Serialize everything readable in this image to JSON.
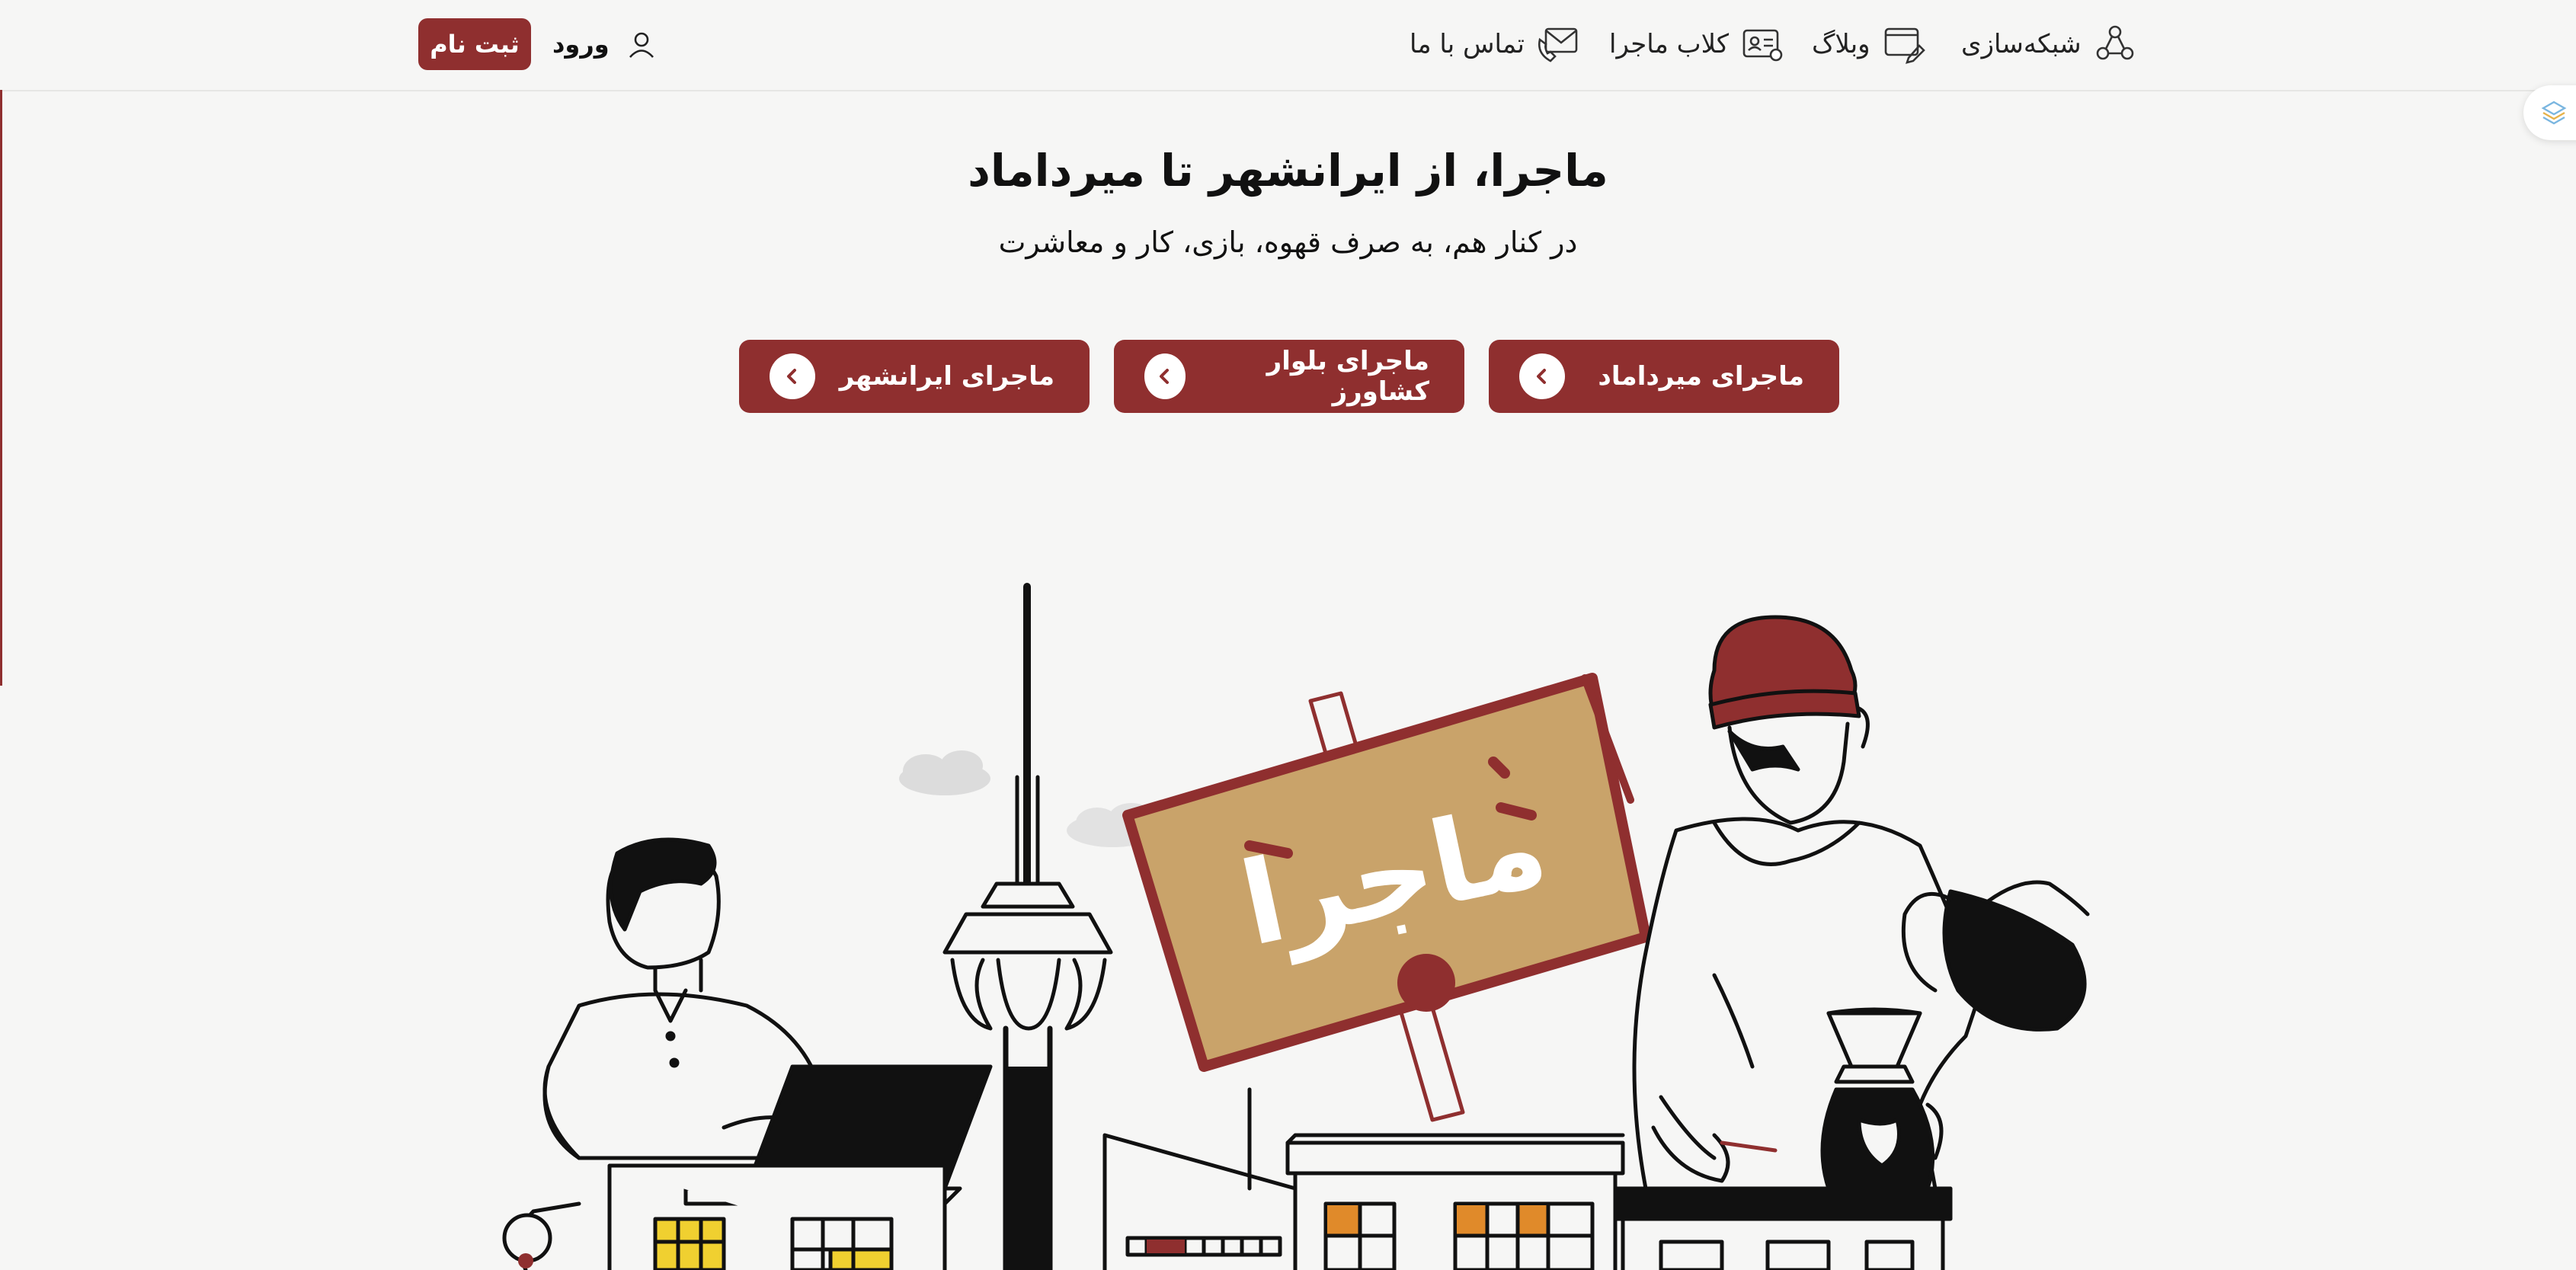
{
  "header": {
    "nav": [
      {
        "label": "شبکه‌سازی",
        "icon": "network-icon"
      },
      {
        "label": "وبلاگ",
        "icon": "blog-icon"
      },
      {
        "label": "کلاب ماجرا",
        "icon": "club-card-icon"
      },
      {
        "label": "تماس با ما",
        "icon": "phone-mail-icon"
      }
    ],
    "login_label": "ورود",
    "signup_label": "ثبت نام"
  },
  "hero": {
    "title": "ماجرا، از ایرانشهر تا میرداماد",
    "subtitle": "در کنار هم، به صرف قهوه، بازی، کار و معاشرت"
  },
  "branches": [
    {
      "label": "ماجرای میرداماد"
    },
    {
      "label": "ماجرای بلوار کشاورز"
    },
    {
      "label": "ماجرای ایرانشهر"
    }
  ],
  "illustration": {
    "sign_text": "ماجرا",
    "colors": {
      "brand": "#8f2f2f",
      "sign": "#c9a36a",
      "window_orange": "#e08a2a",
      "window_yellow": "#f0d030"
    }
  },
  "colors": {
    "primary": "#8f2f2f",
    "background": "#f6f6f5",
    "text": "#111111"
  }
}
